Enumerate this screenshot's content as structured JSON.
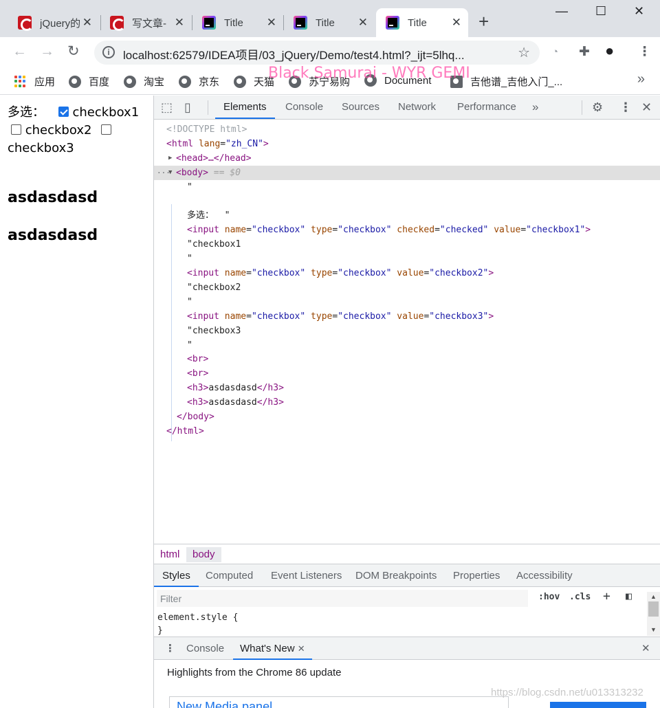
{
  "tabs": [
    {
      "title": "jQuery的",
      "icon": "csdn-favicon-icon"
    },
    {
      "title": "写文章-",
      "icon": "csdn-favicon-icon"
    },
    {
      "title": "Title",
      "icon": "intellij-favicon-icon"
    },
    {
      "title": "Title",
      "icon": "intellij-favicon-icon"
    },
    {
      "title": "Title",
      "icon": "intellij-favicon-icon",
      "active": true
    }
  ],
  "toolbar": {
    "url": "localhost:62579/IDEA项目/03_jQuery/Demo/test4.html?_ijt=5lhq..."
  },
  "bookmarks": [
    {
      "label": "应用",
      "icon": "apps-grid-icon"
    },
    {
      "label": "百度",
      "icon": "globe-icon"
    },
    {
      "label": "淘宝",
      "icon": "globe-icon"
    },
    {
      "label": "京东",
      "icon": "globe-icon"
    },
    {
      "label": "天猫",
      "icon": "globe-icon"
    },
    {
      "label": "苏宁易购",
      "icon": "globe-icon"
    },
    {
      "label": "Document",
      "icon": "globe-icon"
    },
    {
      "label": "吉他谱_吉他入门_...",
      "icon": "bookmark-icon"
    }
  ],
  "watermark_text": "Black Samurai - WYR GEMI",
  "page": {
    "label": "多选：",
    "checkboxes": [
      {
        "label": "checkbox1",
        "checked": true
      },
      {
        "label": "checkbox2",
        "checked": false
      },
      {
        "label": "checkbox3",
        "checked": false
      }
    ],
    "headings": [
      "asdasdasd",
      "asdasdasd"
    ]
  },
  "devtools": {
    "tabs": [
      "Elements",
      "Console",
      "Sources",
      "Network",
      "Performance"
    ],
    "active_tab": "Elements",
    "more": "»",
    "dom_lines": {
      "doctype": "<!DOCTYPE html>",
      "html_open_tag": "html",
      "html_lang_attr": "lang",
      "html_lang_val": "\"zh_CN\"",
      "head_text": "<head>…</head>",
      "body_tag": "<body>",
      "body_marker": " == $0",
      "quote1": "\"",
      "text_line": "多选：  \"",
      "input1": {
        "name": "\"checkbox\"",
        "type": "\"checkbox\"",
        "checked": "\"checked\"",
        "value": "\"checkbox1\""
      },
      "text_cb1": "\"checkbox1",
      "input2": {
        "name": "\"checkbox\"",
        "type": "\"checkbox\"",
        "value": "\"checkbox2\""
      },
      "text_cb2": "\"checkbox2",
      "input3": {
        "name": "\"checkbox\"",
        "type": "\"checkbox\"",
        "value": "\"checkbox3\""
      },
      "text_cb3": "\"checkbox3",
      "br": "<br>",
      "h3_text": "asdasdasd",
      "body_close": "</body>",
      "html_close": "</html>"
    },
    "breadcrumbs": [
      "html",
      "body"
    ],
    "styles_tabs": [
      "Styles",
      "Computed",
      "Event Listeners",
      "DOM Breakpoints",
      "Properties",
      "Accessibility"
    ],
    "filter_placeholder": "Filter",
    "hov": ":hov",
    "cls": ".cls",
    "element_style": "element.style {",
    "element_style_close": "}",
    "drawer_tabs": [
      "Console",
      "What's New"
    ],
    "whats_new_heading": "Highlights from the Chrome 86 update",
    "whats_new_card": "New Media panel",
    "csdn_watermark": "https://blog.csdn.net/u013313232"
  },
  "colors": {
    "accent": "#1a73e8",
    "tag": "#881280",
    "attr": "#994500",
    "attr_value": "#1a1aa6"
  }
}
